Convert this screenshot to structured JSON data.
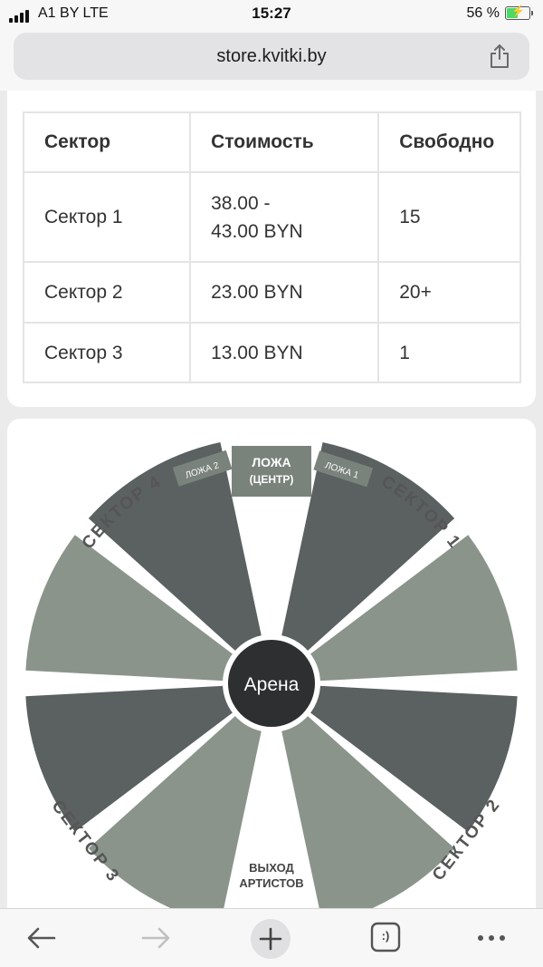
{
  "status_bar": {
    "carrier": "A1 BY  LTE",
    "time": "15:27",
    "battery_percent": "56 %",
    "battery_level": 0.56
  },
  "browser": {
    "url": "store.kvitki.by"
  },
  "table": {
    "headers": [
      "Сектор",
      "Стоимость",
      "Свободно"
    ],
    "rows": [
      {
        "sector": "Сектор 1",
        "price": "38.00 - 43.00 BYN",
        "free": "15"
      },
      {
        "sector": "Сектор 2",
        "price": "23.00 BYN",
        "free": "20+"
      },
      {
        "sector": "Сектор 3",
        "price": "13.00 BYN",
        "free": "1"
      }
    ]
  },
  "venue_map": {
    "arena_label": "Арена",
    "box_center": [
      "ЛОЖА",
      "(ЦЕНТР)"
    ],
    "box_1": "ЛОЖА 1",
    "box_2": "ЛОЖА 2",
    "sector_1": "СЕКТОР 1",
    "sector_2": "СЕКТОР 2",
    "sector_3": "СЕКТОР 3",
    "sector_4": "СЕКТОР 4",
    "artists_exit": [
      "ВЫХОД",
      "АРТИСТОВ"
    ],
    "colors": {
      "dark": "#5a6160",
      "light": "#8a948b",
      "arena": "#2d2f30"
    }
  },
  "toolbar": {
    "icons": [
      "back-arrow-icon",
      "forward-arrow-icon",
      "new-tab-plus-icon",
      "tabs-icon",
      "more-icon"
    ],
    "tabs_glyph": ":)"
  }
}
